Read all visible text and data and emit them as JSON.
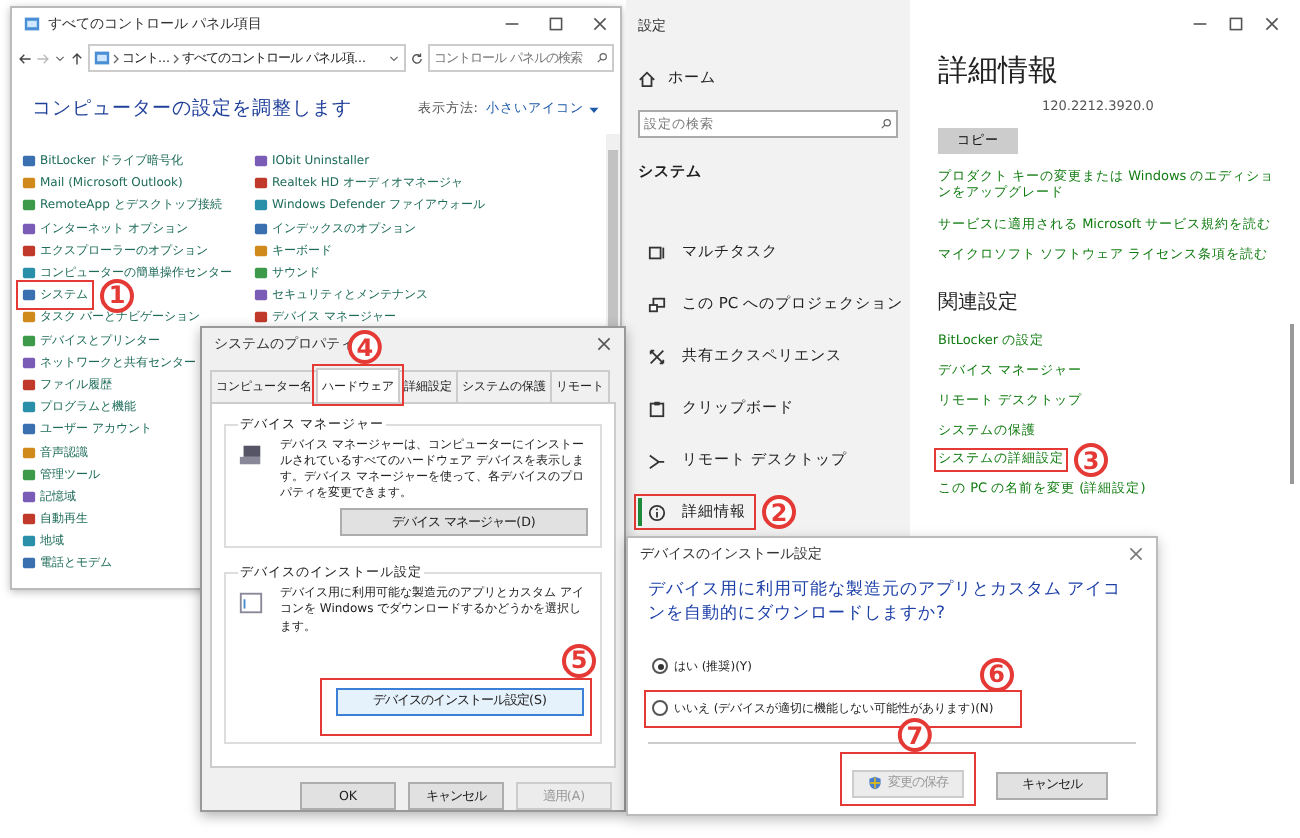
{
  "control_panel": {
    "title": "すべてのコントロール パネル項目",
    "breadcrumb": [
      "コント...",
      "すべてのコントロール パネル項..."
    ],
    "search_placeholder": "コントロール パネルの検索",
    "heading": "コンピューターの設定を調整します",
    "view_label": "表示方法:",
    "view_value": "小さいアイコン",
    "items_left": [
      {
        "label": "BitLocker ドライブ暗号化"
      },
      {
        "label": "Mail (Microsoft Outlook)"
      },
      {
        "label": "RemoteApp とデスクトップ接続"
      },
      {
        "label": "インターネット オプション"
      },
      {
        "label": "エクスプローラーのオプション"
      },
      {
        "label": "コンピューターの簡単操作センター"
      },
      {
        "label": "システム",
        "callout": "1"
      },
      {
        "label": "タスク バーとナビゲーション"
      },
      {
        "label": "デバイスとプリンター"
      },
      {
        "label": "ネットワークと共有センター"
      },
      {
        "label": "ファイル履歴"
      },
      {
        "label": "プログラムと機能"
      },
      {
        "label": "ユーザー アカウント"
      },
      {
        "label": "音声認識"
      },
      {
        "label": "管理ツール"
      },
      {
        "label": "記憶域"
      },
      {
        "label": "自動再生"
      },
      {
        "label": "地域"
      },
      {
        "label": "電話とモデム"
      }
    ],
    "items_right": [
      {
        "label": "IObit Uninstaller"
      },
      {
        "label": "Realtek HD オーディオマネージャ"
      },
      {
        "label": "Windows Defender ファイアウォール"
      },
      {
        "label": "インデックスのオプション"
      },
      {
        "label": "キーボード"
      },
      {
        "label": "サウンド"
      },
      {
        "label": "セキュリティとメンテナンス"
      },
      {
        "label": "デバイス マネージャー"
      }
    ]
  },
  "system_properties": {
    "title": "システムのプロパティ",
    "tabs": [
      {
        "label": "コンピューター名",
        "selected": false
      },
      {
        "label": "ハードウェア",
        "selected": true,
        "callout": "4"
      },
      {
        "label": "詳細設定",
        "selected": false
      },
      {
        "label": "システムの保護",
        "selected": false
      },
      {
        "label": "リモート",
        "selected": false
      }
    ],
    "groups": [
      {
        "title": "デバイス マネージャー",
        "text": "デバイス マネージャーは、コンピューターにインストールされているすべてのハードウェア デバイスを表示します。デバイス マネージャーを使って、各デバイスのプロパティを変更できます。",
        "button": {
          "label": "デバイス マネージャー(D)"
        }
      },
      {
        "title": "デバイスのインストール設定",
        "text": "デバイス用に利用可能な製造元のアプリとカスタム アイコンを Windows でダウンロードするかどうかを選択します。",
        "button": {
          "label": "デバイスのインストール設定(S)",
          "callout": "5"
        }
      }
    ],
    "buttons": [
      {
        "label": "OK",
        "disabled": false
      },
      {
        "label": "キャンセル",
        "disabled": false
      },
      {
        "label": "適用(A)",
        "disabled": true
      }
    ]
  },
  "settings_nav": {
    "title": "設定",
    "home": "ホーム",
    "search_placeholder": "設定の検索",
    "section": "システム",
    "items": [
      {
        "label": "マルチタスク",
        "selected": false
      },
      {
        "label": "この PC へのプロジェクション",
        "selected": false
      },
      {
        "label": "共有エクスペリエンス",
        "selected": false
      },
      {
        "label": "クリップボード",
        "selected": false
      },
      {
        "label": "リモート デスクトップ",
        "selected": false
      },
      {
        "label": "詳細情報",
        "selected": true,
        "callout": "2"
      }
    ]
  },
  "about": {
    "heading": "詳細情報",
    "version": "120.2212.3920.0",
    "copy_button": "コピー",
    "links": [
      {
        "label": "プロダクト キーの変更または Windows のエディションをアップグレード"
      },
      {
        "label": "サービスに適用される Microsoft サービス規約を読む"
      },
      {
        "label": "マイクロソフト ソフトウェア ライセンス条項を読む"
      }
    ],
    "related_heading": "関連設定",
    "related_links": [
      {
        "label": "BitLocker の設定"
      },
      {
        "label": "デバイス マネージャー"
      },
      {
        "label": "リモート デスクトップ"
      },
      {
        "label": "システムの保護"
      },
      {
        "label": "システムの詳細設定",
        "callout": "3"
      },
      {
        "label": "この PC の名前を変更 (詳細設定)"
      }
    ]
  },
  "device_install": {
    "title": "デバイスのインストール設定",
    "question": "デバイス用に利用可能な製造元のアプリとカスタム アイコンを自動的にダウンロードしますか?",
    "options": [
      {
        "label": "はい (推奨)(Y)",
        "selected": true
      },
      {
        "label": "いいえ (デバイスが適切に機能しない可能性があります)(N)",
        "selected": false,
        "callout": "6"
      }
    ],
    "buttons": [
      {
        "label": "変更の保存",
        "kind": "shield",
        "disabled": true,
        "callout": "7"
      },
      {
        "label": "キャンセル",
        "kind": "plain",
        "disabled": false
      }
    ]
  }
}
